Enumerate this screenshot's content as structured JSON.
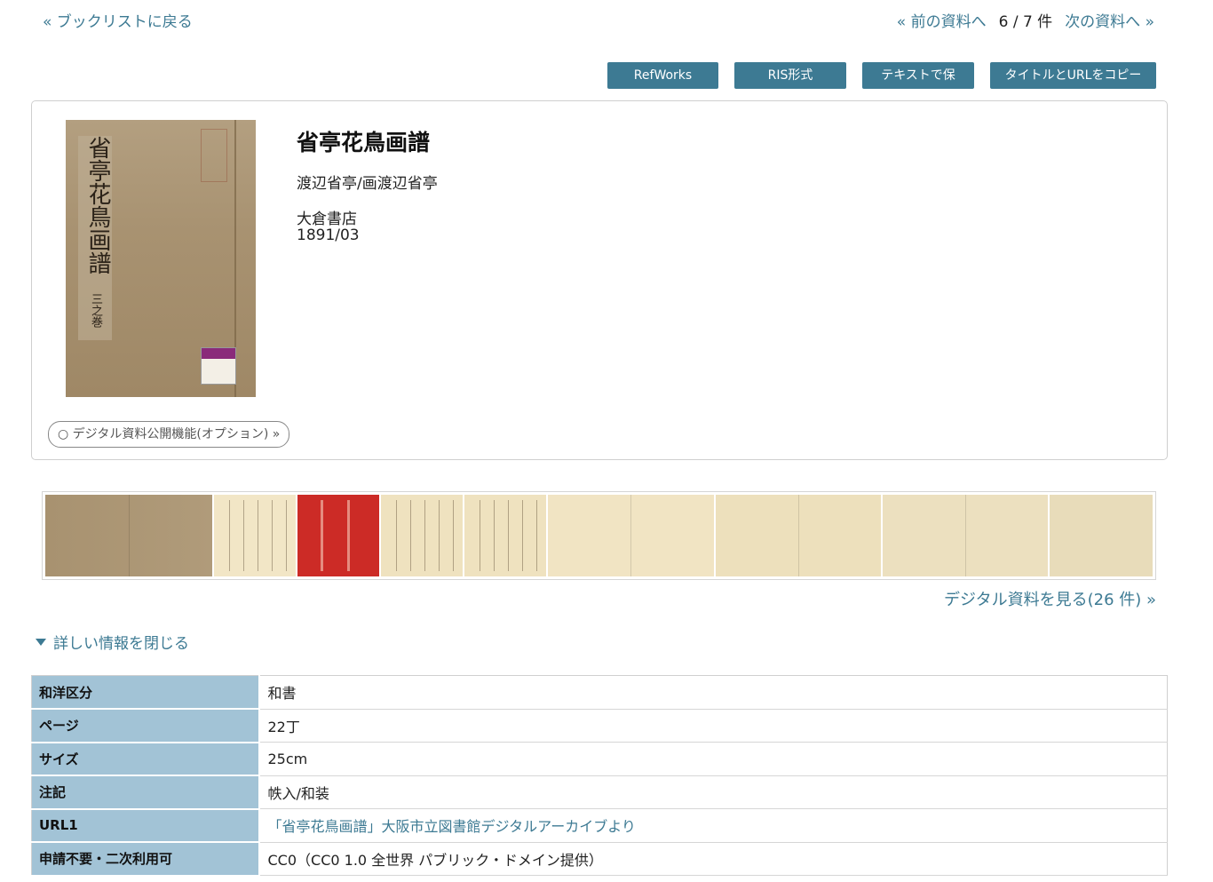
{
  "nav": {
    "back": "« ブックリストに戻る",
    "prev": "« 前の資料へ",
    "count": "6 / 7 件",
    "next": "次の資料へ »"
  },
  "toolbar": {
    "refworks": "RefWorks",
    "ris": "RIS形式",
    "save_text": "テキストで保存",
    "copy_title_url": "タイトルとURLをコピー"
  },
  "record": {
    "title": "省亭花鳥画譜",
    "author": "渡辺省亭/画渡辺省亭",
    "publisher": "大倉書店",
    "date": "1891/03",
    "cover_calligraphy": "省亭花鳥画譜",
    "cover_volume": "三之巻",
    "option_button": "○ デジタル資料公開機能(オプション) »"
  },
  "digital": {
    "view_link": "デジタル資料を見る(26 件) »",
    "thumbnail_count": 9
  },
  "details_toggle": "詳しい情報を閉じる",
  "details": [
    {
      "label": "和洋区分",
      "value": "和書"
    },
    {
      "label": "ページ",
      "value": "22丁"
    },
    {
      "label": "サイズ",
      "value": "25cm"
    },
    {
      "label": "注記",
      "value": "帙入/和装"
    },
    {
      "label": "URL1",
      "value": "「省亭花鳥画譜」大阪市立図書館デジタルアーカイブより"
    },
    {
      "label": "申請不要・二次利用可",
      "value": "CC0（CC0 1.0 全世界 パブリック・ドメイン提供）"
    }
  ],
  "colors": {
    "accent": "#3d7a93",
    "table_header": "#a2c3d6"
  }
}
